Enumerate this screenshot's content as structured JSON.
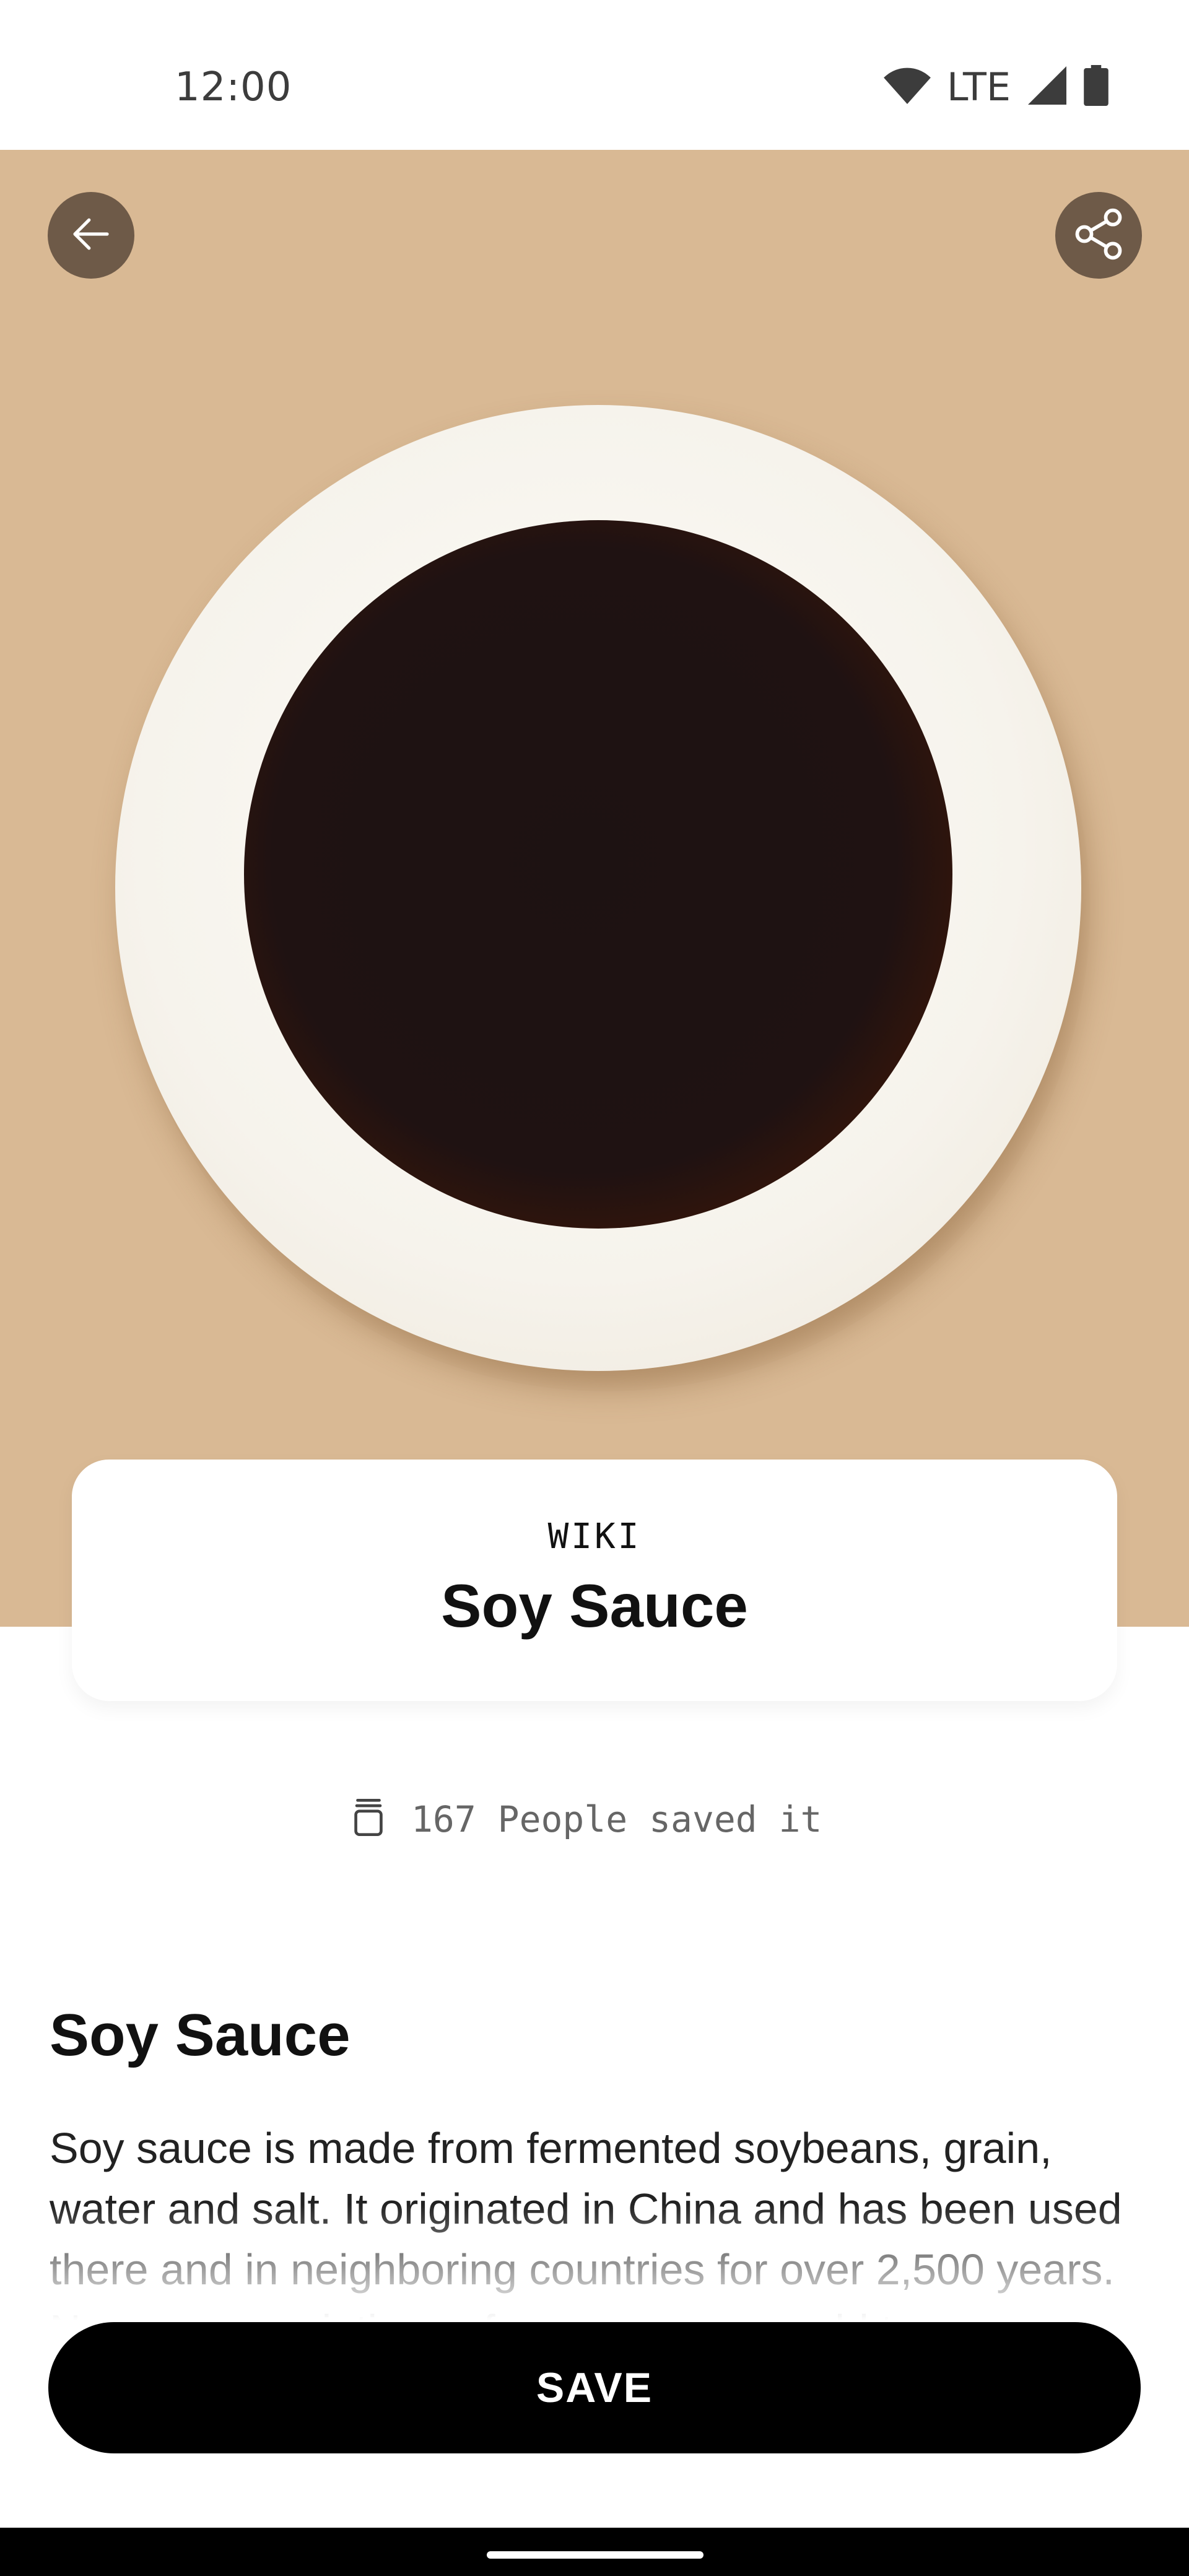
{
  "status_bar": {
    "time": "12:00",
    "network": "LTE",
    "icons": [
      "wifi-icon",
      "signal-icon",
      "battery-icon"
    ]
  },
  "hero": {
    "background_color": "#d9b994",
    "back_icon": "arrow-left-icon",
    "share_icon": "share-icon"
  },
  "card": {
    "eyebrow": "WIKI",
    "title": "Soy Sauce"
  },
  "saved": {
    "icon": "jar-icon",
    "text": "167 People saved it"
  },
  "article": {
    "title": "Soy Sauce",
    "body": "Soy sauce is made from fermented soybeans, grain, water and salt. It originated in China and has been used there and in neighboring countries for over 2,500 years. Numerous variations of soy sauce are sold to"
  },
  "actions": {
    "save_label": "SAVE"
  }
}
